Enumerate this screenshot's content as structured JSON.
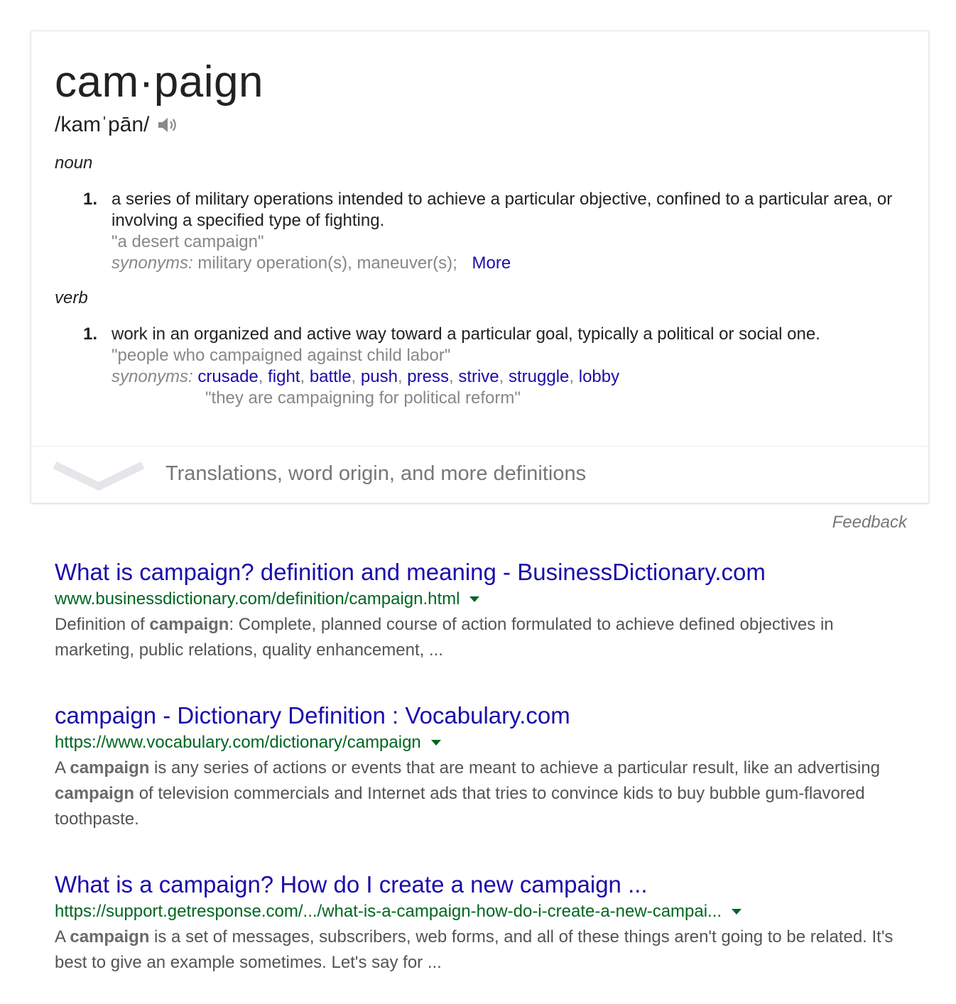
{
  "definition": {
    "word": "cam·paign",
    "phonetic": "/kamˈpān/",
    "noun": {
      "label": "noun",
      "number": "1.",
      "text": "a series of military operations intended to achieve a particular objective, confined to a particular area, or involving a specified type of fighting.",
      "example": "\"a desert campaign\"",
      "synonyms_label": "synonyms:",
      "synonyms_text": "military operation(s), maneuver(s);",
      "more_label": "More"
    },
    "verb": {
      "label": "verb",
      "number": "1.",
      "text": "work in an organized and active way toward a particular goal, typically a political or social one.",
      "example": "\"people who campaigned against child labor\"",
      "synonyms_label": "synonyms:",
      "synonyms": [
        "crusade",
        "fight",
        "battle",
        "push",
        "press",
        "strive",
        "struggle",
        "lobby"
      ],
      "synonym_example": "\"they are campaigning for political reform\""
    },
    "expander_label": "Translations, word origin, and more definitions"
  },
  "feedback_label": "Feedback",
  "results": [
    {
      "title": "What is campaign? definition and meaning - BusinessDictionary.com",
      "url": "www.businessdictionary.com/definition/campaign.html",
      "snippet_parts": [
        "Definition of ",
        "campaign",
        ": Complete, planned course of action formulated to achieve defined objectives in marketing, public relations, quality enhancement, ..."
      ]
    },
    {
      "title": "campaign - Dictionary Definition : Vocabulary.com",
      "url": "https://www.vocabulary.com/dictionary/campaign",
      "snippet_parts": [
        "A ",
        "campaign",
        " is any series of actions or events that are meant to achieve a particular result, like an advertising ",
        "campaign",
        " of television commercials and Internet ads that tries to convince kids to buy bubble gum-flavored toothpaste."
      ]
    },
    {
      "title": "What is a campaign? How do I create a new campaign ...",
      "url": "https://support.getresponse.com/.../what-is-a-campaign-how-do-i-create-a-new-campai...",
      "snippet_parts": [
        "A ",
        "campaign",
        " is a set of messages, subscribers, web forms, and all of these things aren't going to be related. It's best to give an example sometimes. Let's say for ..."
      ]
    }
  ],
  "colors": {
    "link": "#1a0dab",
    "url": "#006621",
    "snippet": "#545454",
    "muted": "#878787"
  }
}
